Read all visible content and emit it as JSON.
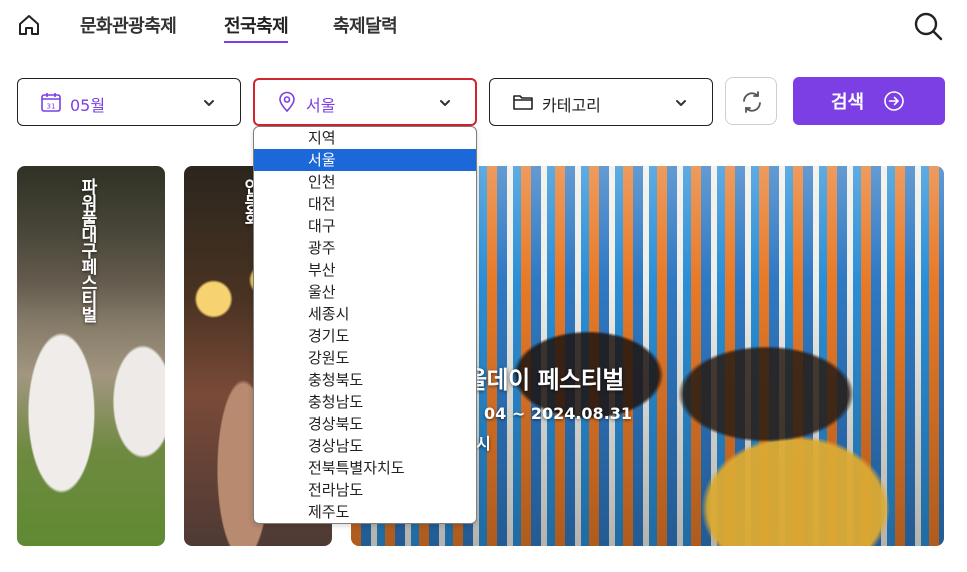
{
  "nav": {
    "items": [
      {
        "label": "문화관광축제",
        "active": false
      },
      {
        "label": "전국축제",
        "active": true
      },
      {
        "label": "축제달력",
        "active": false
      }
    ]
  },
  "filters": {
    "month": {
      "value": "05월",
      "icon": "calendar-icon"
    },
    "region": {
      "value": "서울",
      "icon": "location-pin-icon"
    },
    "category": {
      "value": "카테고리",
      "icon": "folder-icon"
    },
    "search_label": "검색"
  },
  "region_dropdown": {
    "selected": "서울",
    "options": [
      "지역",
      "서울",
      "인천",
      "대전",
      "대구",
      "광주",
      "부산",
      "울산",
      "세종시",
      "경기도",
      "강원도",
      "충청북도",
      "충청남도",
      "경상북도",
      "경상남도",
      "전북특별자치도",
      "전라남도",
      "제주도"
    ]
  },
  "cards": [
    {
      "title": "파워풀대구페스티벌"
    },
    {
      "title": "연등회"
    },
    {
      "title": "올데이 페스티벌",
      "date": "04 ~ 2024.08.31",
      "location": "시"
    }
  ],
  "colors": {
    "accent": "#7b3fe4",
    "highlight": "#1d68d8",
    "focus_border": "#d3232f"
  }
}
